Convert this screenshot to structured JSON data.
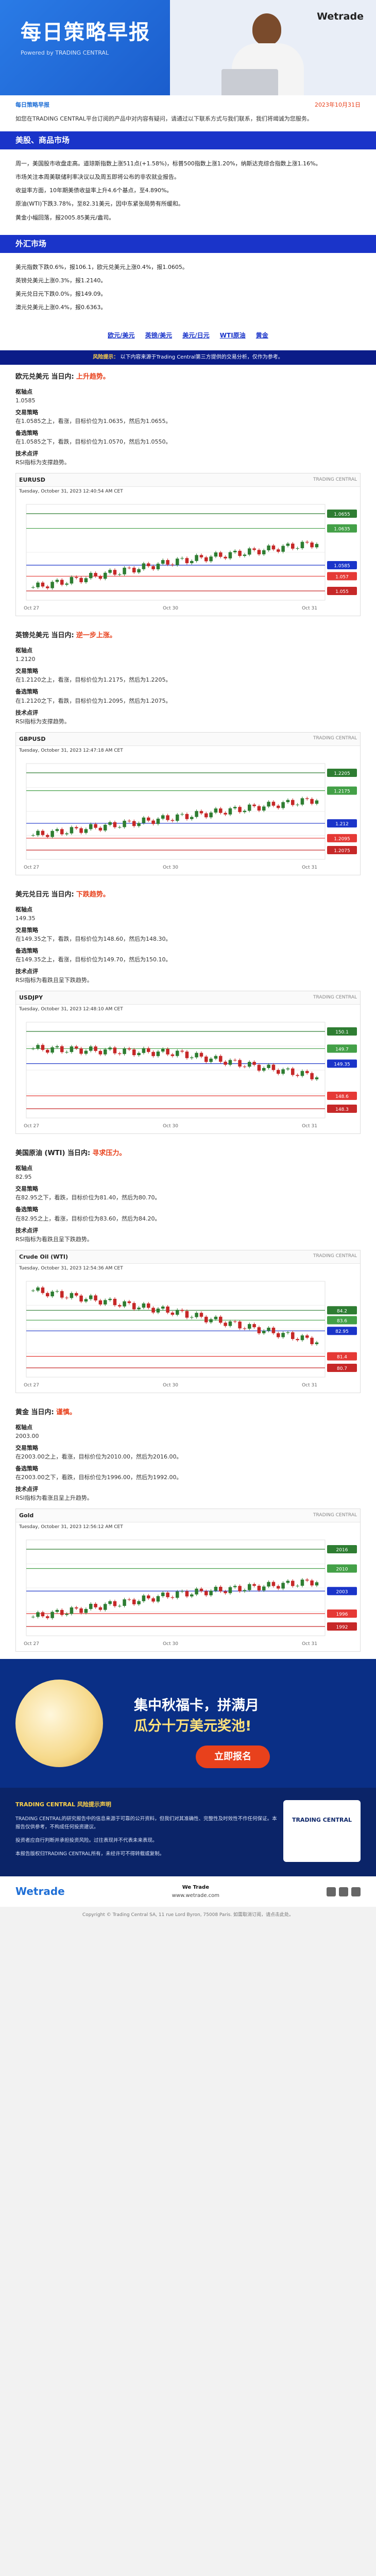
{
  "header": {
    "title": "每日策略早报",
    "powered": "Powered by TRADING CENTRAL",
    "logo_text": "Wetrade",
    "date_left": "每日策略早报",
    "date_right": "2023年10月31日"
  },
  "intro": "如您在TRADING CENTRAL平台订阅的产品中对内容有疑问，请通过以下联系方式与我们联系，我们将竭诚为您服务。",
  "sections": {
    "market": {
      "title": "美股、商品市场",
      "paras": [
        "周一，美国股市收盘走高。道琼斯指数上涨511点(+1.58%)，标普500指数上涨1.20%，纳斯达克综合指数上涨1.16%。",
        "市场关注本周美联储利率决议以及周五即将公布的非农就业报告。",
        "收益率方面，10年期美债收益率上升4.6个基点，至4.890%。",
        "原油(WTI)下跌3.78%，至82.31美元，因中东紧张局势有所缓和。",
        "黄金小幅回落，报2005.85美元/盎司。"
      ]
    },
    "fx": {
      "title": "外汇市场",
      "paras": [
        "美元指数下跌0.6%，报106.1，欧元兑美元上涨0.4%，报1.0605。",
        "英镑兑美元上涨0.3%，报1.2140。",
        "美元兑日元下跌0.0%，报149.09。",
        "澳元兑美元上涨0.4%，报0.6363。"
      ]
    }
  },
  "links": [
    "欧元/美元",
    "英镑/美元",
    "美元/日元",
    "WTI原油",
    "黄金"
  ],
  "notice_left": "风险提示：",
  "notice_text": "以下内容来源于Trading Central第三方提供的交易分析，仅作为参考。",
  "instruments": [
    {
      "id": "eurusd",
      "name": "欧元兑美元 当日内:",
      "trend": "上升趋势。",
      "pivot_k": "枢轴点",
      "pivot_v": "1.0585",
      "strategy_k": "交易策略",
      "strategy_v": "在1.0585之上，看涨，目标价位为1.0635，然后为1.0655。",
      "alt_k": "备选策略",
      "alt_v": "在1.0585之下，看跌，目标价位为1.0570，然后为1.0550。",
      "tech_k": "技术点评",
      "tech_v": "RSI指标为支撑趋势。",
      "symbol": "EURUSD",
      "time": "Tuesday, October 31, 2023 12:40:54 AM CET"
    },
    {
      "id": "gbpusd",
      "name": "英镑兑美元 当日内:",
      "trend": "逆一步上涨。",
      "pivot_k": "枢轴点",
      "pivot_v": "1.2120",
      "strategy_k": "交易策略",
      "strategy_v": "在1.2120之上，看涨，目标价位为1.2175，然后为1.2205。",
      "alt_k": "备选策略",
      "alt_v": "在1.2120之下，看跌，目标价位为1.2095，然后为1.2075。",
      "tech_k": "技术点评",
      "tech_v": "RSI指标为支撑趋势。",
      "symbol": "GBPUSD",
      "time": "Tuesday, October 31, 2023 12:47:18 AM CET"
    },
    {
      "id": "usdjpy",
      "name": "美元兑日元 当日内:",
      "trend": "下跌趋势。",
      "pivot_k": "枢轴点",
      "pivot_v": "149.35",
      "strategy_k": "交易策略",
      "strategy_v": "在149.35之下，看跌，目标价位为148.60，然后为148.30。",
      "alt_k": "备选策略",
      "alt_v": "在149.35之上，看涨，目标价位为149.70，然后为150.10。",
      "tech_k": "技术点评",
      "tech_v": "RSI指标为看跌且呈下跌趋势。",
      "symbol": "USDJPY",
      "time": "Tuesday, October 31, 2023 12:48:10 AM CET"
    },
    {
      "id": "wti",
      "name": "美国原油 (WTI) 当日内:",
      "trend": "寻求压力。",
      "pivot_k": "枢轴点",
      "pivot_v": "82.95",
      "strategy_k": "交易策略",
      "strategy_v": "在82.95之下，看跌，目标价位为81.40，然后为80.70。",
      "alt_k": "备选策略",
      "alt_v": "在82.95之上，看涨，目标价位为83.60，然后为84.20。",
      "tech_k": "技术点评",
      "tech_v": "RSI指标为看跌且呈下跌趋势。",
      "symbol": "Crude Oil (WTI)",
      "time": "Tuesday, October 31, 2023 12:54:36 AM CET"
    },
    {
      "id": "gold",
      "name": "黄金 当日内:",
      "trend": "谨慎。",
      "pivot_k": "枢轴点",
      "pivot_v": "2003.00",
      "strategy_k": "交易策略",
      "strategy_v": "在2003.00之上，看涨，目标价位为2010.00，然后为2016.00。",
      "alt_k": "备选策略",
      "alt_v": "在2003.00之下，看跌，目标价位为1996.00，然后为1992.00。",
      "tech_k": "技术点评",
      "tech_v": "RSI指标为看涨且呈上升趋势。",
      "symbol": "Gold",
      "time": "Tuesday, October 31, 2023 12:56:12 AM CET"
    }
  ],
  "promo": {
    "line1": "集中秋福卡，拼满月",
    "line2": "瓜分十万美元奖池!",
    "button": "立即报名"
  },
  "disclaimer": {
    "head": "TRADING CENTRAL 风险提示声明",
    "p1": "TRADING CENTRAL的研究报告中的信息来源于可靠的公开资料，但我们对其准确性、完整性及时效性不作任何保证。本报告仅供参考，不构成任何投资建议。",
    "p2": "投资者应自行判断并承担投资风险。过往表现并不代表未来表现。",
    "p3": "本报告版权归TRADING CENTRAL所有，未经许可不得转载或复制。",
    "badge": "TRADING CENTRAL"
  },
  "footer": {
    "brand": "Wetrade",
    "line1": "We Trade",
    "line2": "www.wetrade.com",
    "bottom": "Copyright © Trading Central SA, 11 rue Lord Byron, 75008 Paris. 如需取消订阅，请点击此处。"
  },
  "chart_data": [
    {
      "type": "line",
      "symbol": "EURUSD",
      "x": [
        "Oct 27",
        "Oct 30",
        "Oct 31"
      ],
      "y": [
        1.0555,
        1.059,
        1.0615
      ],
      "levels": [
        1.0655,
        1.0635,
        1.0585,
        1.057,
        1.055
      ]
    },
    {
      "type": "line",
      "symbol": "GBPUSD",
      "x": [
        "Oct 27",
        "Oct 30",
        "Oct 31"
      ],
      "y": [
        1.21,
        1.213,
        1.216
      ],
      "levels": [
        1.2205,
        1.2175,
        1.212,
        1.2095,
        1.2075
      ]
    },
    {
      "type": "line",
      "symbol": "USDJPY",
      "x": [
        "Oct 27",
        "Oct 30",
        "Oct 31"
      ],
      "y": [
        149.7,
        149.6,
        149.05
      ],
      "levels": [
        150.1,
        149.7,
        149.35,
        148.6,
        148.3
      ]
    },
    {
      "type": "line",
      "symbol": "Crude Oil (WTI)",
      "x": [
        "Oct 27",
        "Oct 30",
        "Oct 31"
      ],
      "y": [
        85.4,
        84.1,
        82.3
      ],
      "levels": [
        84.2,
        83.6,
        82.95,
        81.4,
        80.7
      ]
    },
    {
      "type": "line",
      "symbol": "Gold",
      "x": [
        "Oct 27",
        "Oct 30",
        "Oct 31"
      ],
      "y": [
        1995,
        2002,
        2006
      ],
      "levels": [
        2016,
        2010,
        2003,
        1996,
        1992
      ]
    }
  ]
}
